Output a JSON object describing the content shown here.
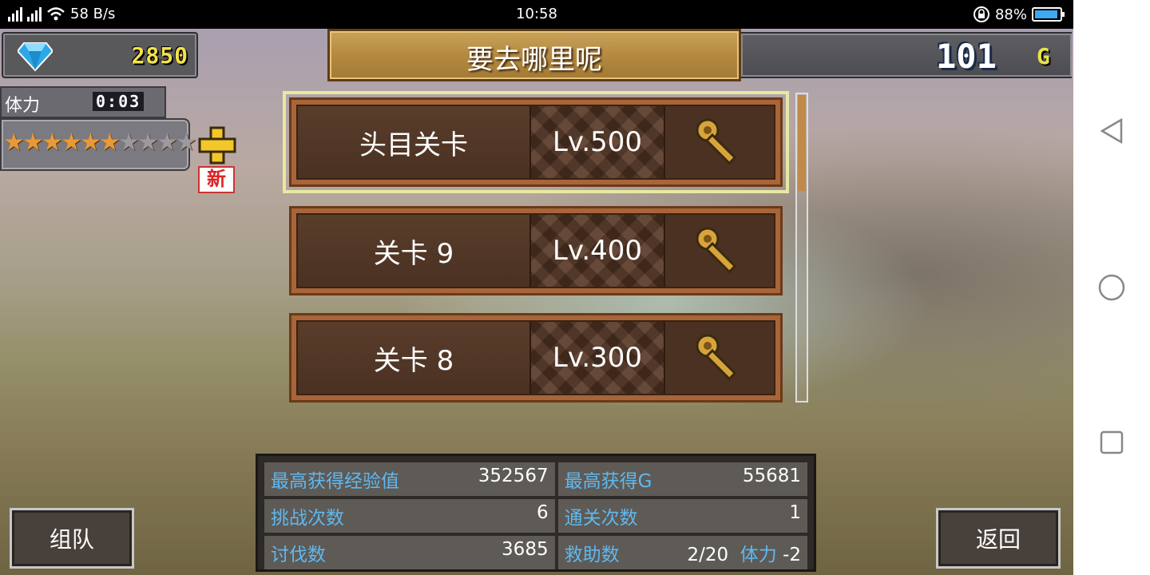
{
  "status_bar": {
    "network": "58 B/s",
    "time": "10:58",
    "battery": "88%"
  },
  "currency": {
    "gems": "2850",
    "gold": "101",
    "gold_symbol": "G"
  },
  "title": "要去哪里呢",
  "stamina": {
    "label": "体力",
    "timer": "0:03",
    "filled": 6,
    "total": 10,
    "new_badge": "新"
  },
  "stages": [
    {
      "name": "头目关卡",
      "level": "Lv.500",
      "selected": true
    },
    {
      "name": "关卡 9",
      "level": "Lv.400",
      "selected": false
    },
    {
      "name": "关卡 8",
      "level": "Lv.300",
      "selected": false
    }
  ],
  "stats": {
    "max_exp_label": "最高获得经验值",
    "max_exp_value": "352567",
    "max_gold_label": "最高获得G",
    "max_gold_value": "55681",
    "challenges_label": "挑战次数",
    "challenges_value": "6",
    "clears_label": "通关次数",
    "clears_value": "1",
    "subjugations_label": "讨伐数",
    "subjugations_value": "3685",
    "assists_label": "救助数",
    "assists_value": "2/20",
    "stamina_cost_label": "体力",
    "stamina_cost_value": "-2"
  },
  "buttons": {
    "team": "组队",
    "back": "返回"
  },
  "colors": {
    "accent_blue": "#5fb8ef",
    "gold_text": "#f3e24a",
    "wood": "#a8653a"
  }
}
